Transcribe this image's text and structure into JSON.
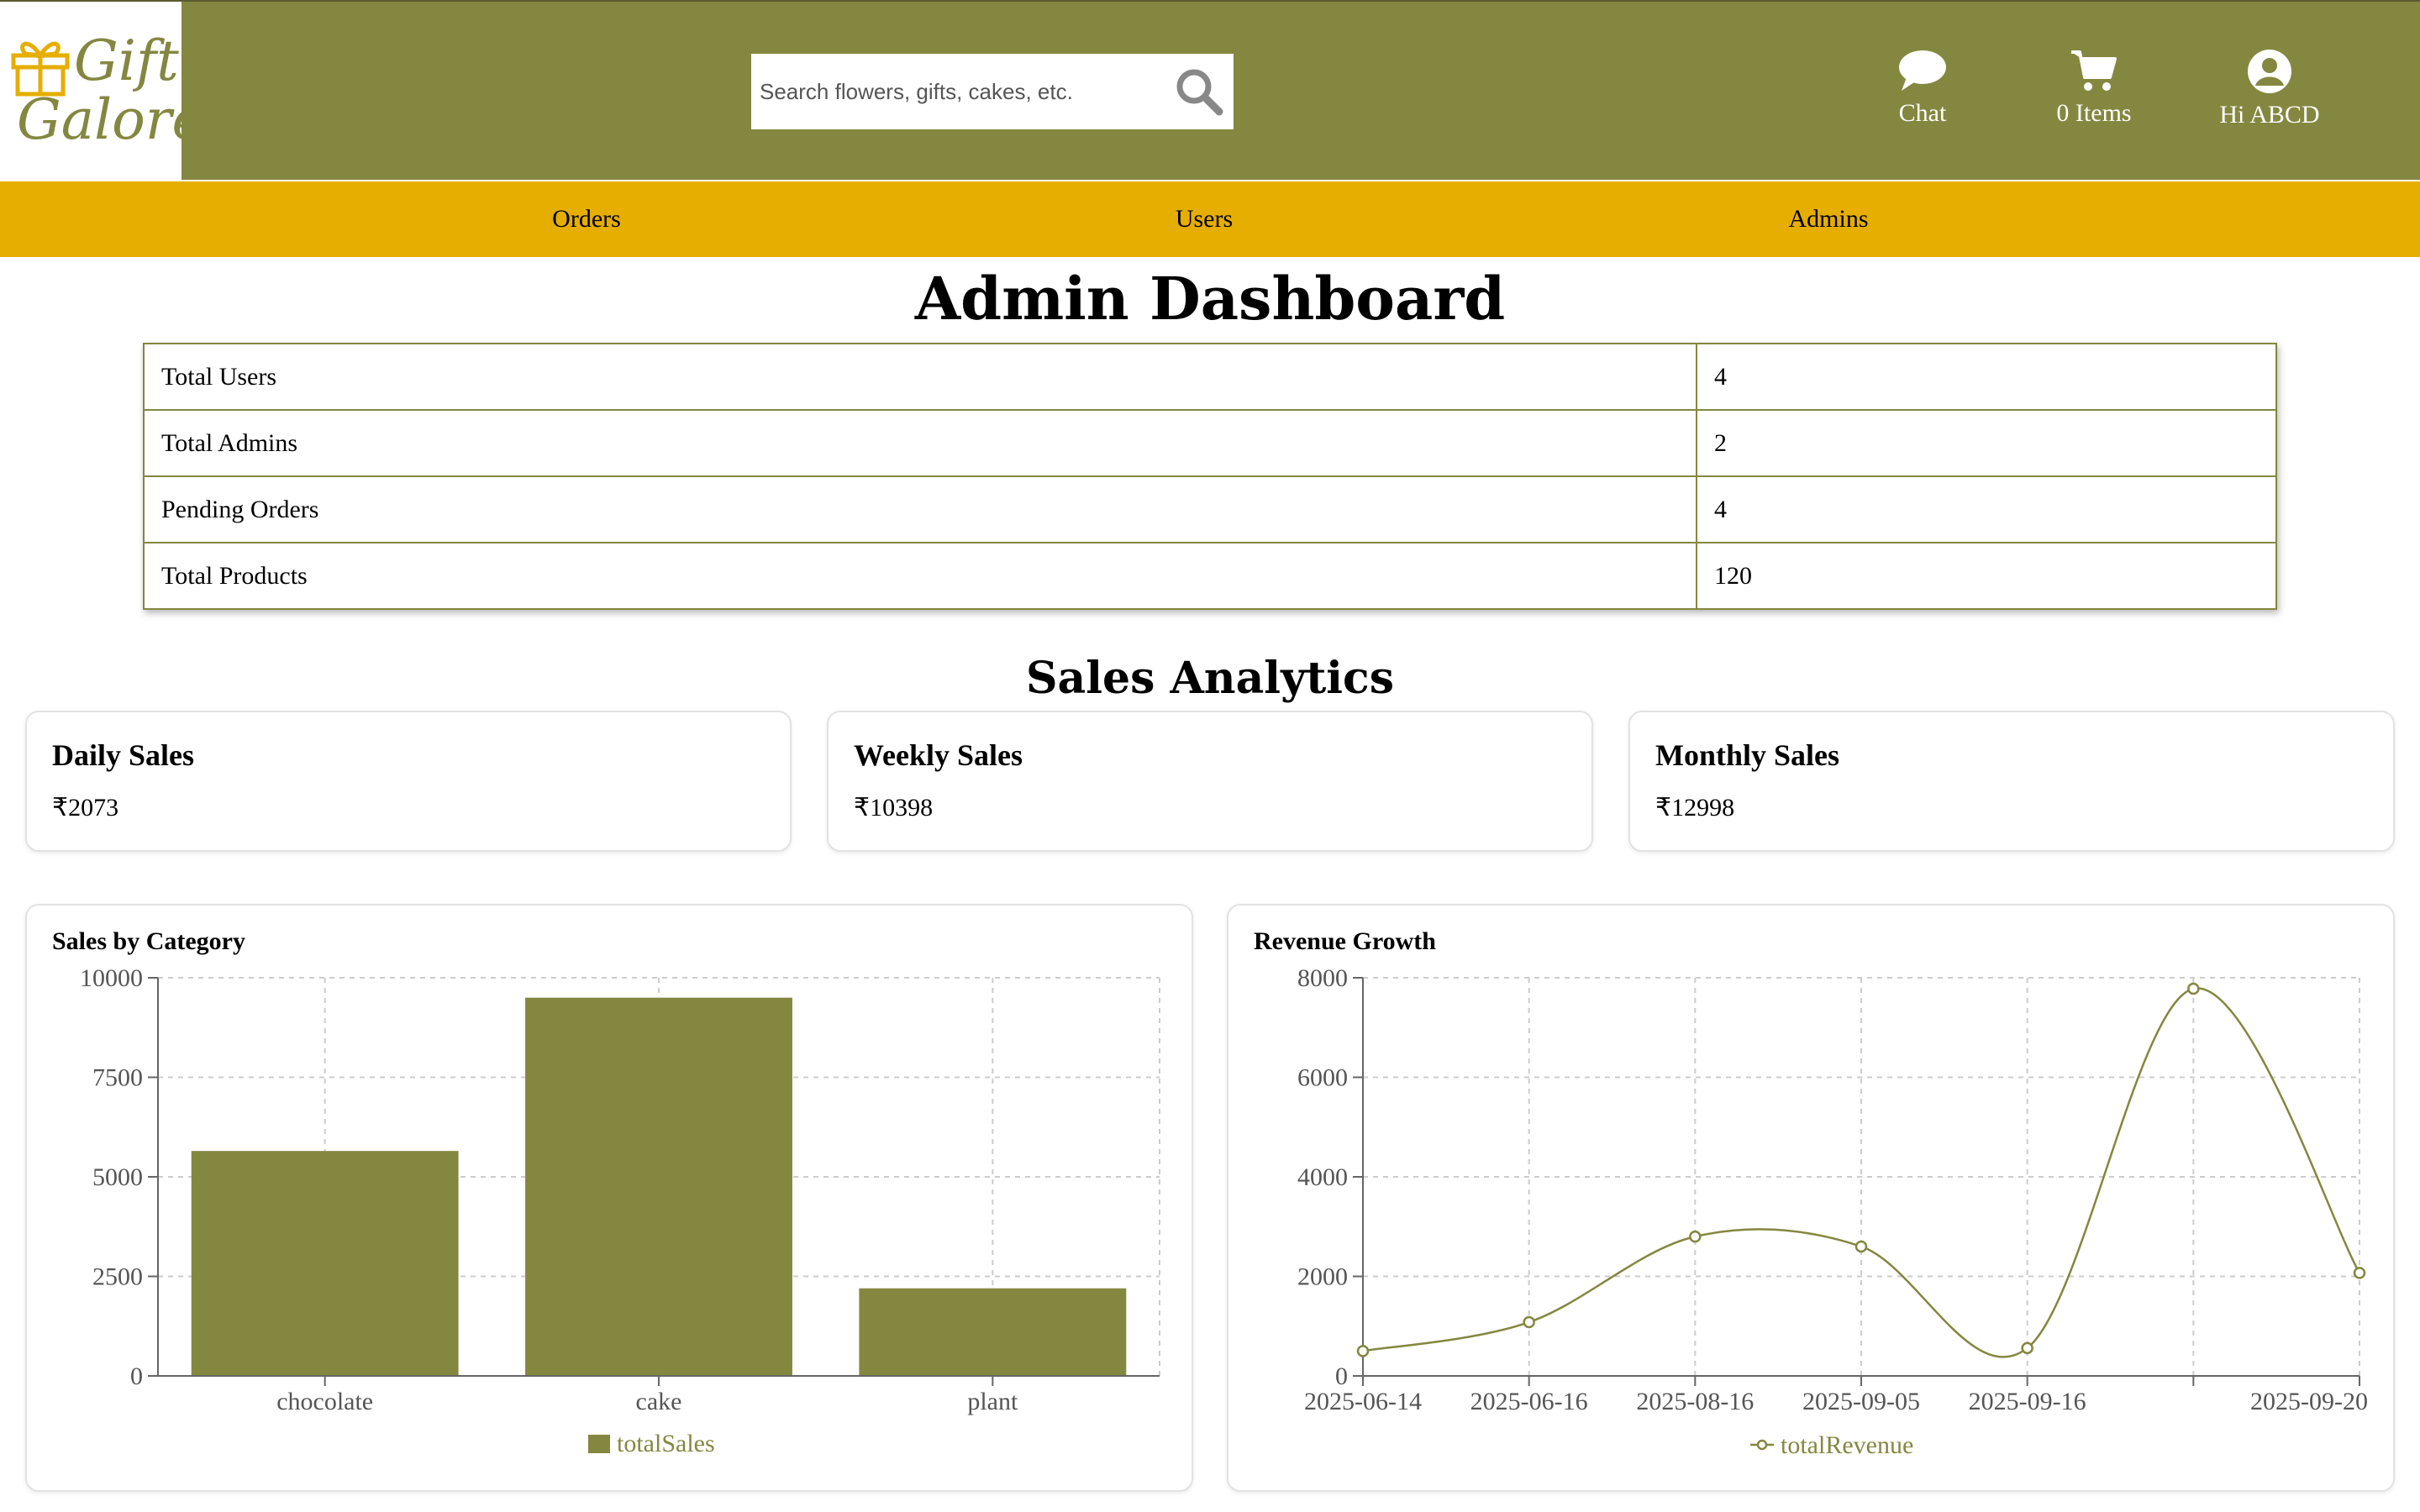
{
  "brand": {
    "line1": "Gift",
    "line2": "Galore",
    "color": "#84873f"
  },
  "search": {
    "placeholder": "Search flowers, gifts, cakes, etc.",
    "icon": "search-icon"
  },
  "header": {
    "chat_label": "Chat",
    "cart_label": "0 Items",
    "user_label": "Hi ABCD"
  },
  "nav": {
    "orders": "Orders",
    "users": "Users",
    "admins": "Admins"
  },
  "page_title": "Admin Dashboard",
  "stats": [
    {
      "label": "Total Users",
      "value": "4"
    },
    {
      "label": "Total Admins",
      "value": "2"
    },
    {
      "label": "Pending Orders",
      "value": "4"
    },
    {
      "label": "Total Products",
      "value": "120"
    }
  ],
  "analytics_title": "Sales Analytics",
  "cards": [
    {
      "title": "Daily Sales",
      "value": "₹2073"
    },
    {
      "title": "Weekly Sales",
      "value": "₹10398"
    },
    {
      "title": "Monthly Sales",
      "value": "₹12998"
    }
  ],
  "colors": {
    "primary": "#84873f",
    "nav": "#e5ae00"
  },
  "chart_data": [
    {
      "type": "bar",
      "title": "Sales by Category",
      "categories": [
        "chocolate",
        "cake",
        "plant"
      ],
      "series": [
        {
          "name": "totalSales",
          "values": [
            5650,
            9500,
            2200
          ]
        }
      ],
      "ylim": [
        0,
        10000
      ],
      "yticks": [
        0,
        2500,
        5000,
        7500,
        10000
      ],
      "grid": true,
      "legend": "bottom-center"
    },
    {
      "type": "line",
      "title": "Revenue Growth",
      "x": [
        "2025-06-14",
        "2025-06-16",
        "2025-08-16",
        "2025-09-05",
        "2025-09-16",
        "",
        "2025-09-20"
      ],
      "series": [
        {
          "name": "totalRevenue",
          "values": [
            500,
            1080,
            2800,
            2600,
            560,
            7780,
            2070
          ]
        }
      ],
      "ylim": [
        0,
        8000
      ],
      "yticks": [
        0,
        2000,
        4000,
        6000,
        8000
      ],
      "grid": true,
      "legend": "bottom-center"
    }
  ]
}
